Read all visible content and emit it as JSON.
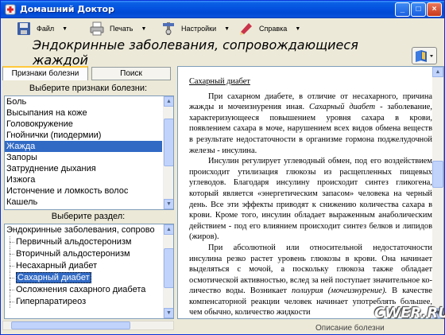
{
  "window": {
    "title": "Домашний Доктор"
  },
  "toolbar": {
    "items": [
      {
        "label": "Файл",
        "icon": "floppy-disk-icon"
      },
      {
        "label": "Печать",
        "icon": "printer-icon"
      },
      {
        "label": "Настройки",
        "icon": "wrench-icon"
      },
      {
        "label": "Справка",
        "icon": "help-icon"
      }
    ]
  },
  "heading": "Эндокринные заболевания, сопровождающиеся жаждой",
  "tabs": [
    "Признаки болезни",
    "Поиск"
  ],
  "symptoms": {
    "label": "Выберите признаки болезни:",
    "items": [
      "Боль",
      "Высыпания на коже",
      "Головокружение",
      "Гнойнички (пиодермии)",
      "Жажда",
      "Запоры",
      "Затруднение дыхания",
      "Изжога",
      "Истончение и ломкость волос",
      "Кашель"
    ],
    "selected": "Жажда"
  },
  "sections": {
    "label": "Выберите раздел:",
    "root": "Эндокринные заболевания, сопрово",
    "children": [
      "Первичный альдостеронизм",
      "Вторичный альдостеронизм",
      "Несахарный диабет",
      "Сахарный диабет",
      "Осложнения сахарного диабета",
      "Гиперпаратиреоз"
    ],
    "selected": "Сахарный диабет"
  },
  "article": {
    "title": "Сахарный диабет",
    "p1_a": "При сахарном диабете, в отличие от несахарного, причина жажды и мочеизнурения иная. ",
    "p1_em": "Сахарный диабет",
    "p1_b": " - заболевание, характеризующееся повышением уровня сахара в крови, появлением сахара в моче, нарушением всех видов обмена веществ в результате недостаточности в организме гормона поджелудочной железы - инсулина.",
    "p2": "Инсулин регулирует углеводный обмен, под его воздействием происходит утилизация глюкозы из расщепленных пищевых углеводов. Благодаря инсулину происходит синтез гликогена, который является «энергетическим запасом» человека на черный день. Все эти эффекты приводят к снижению количества сахара в крови. Кроме того, инсулин обладает выраженным анаболическим действием - под его влиянием происходит синтез белков и липидов (жиров).",
    "p3_a": "При абсолютной или относительной недостаточности инсулина резко растет уровень глюкозы в крови. Она начинает выделяться с мочой, а поскольку глюкоза также обладает осмотической активностью, вслед за ней поступает значительное ко-личество воды. Возникает ",
    "p3_em": "полиурия (мочеизнурение).",
    "p3_b": " В качестве компенсаторной реакции человек начинает употреблять большее, чем обычно, количество жидкости"
  },
  "status": {
    "text": "Описание болезни"
  },
  "watermark": "CWER.RU"
}
